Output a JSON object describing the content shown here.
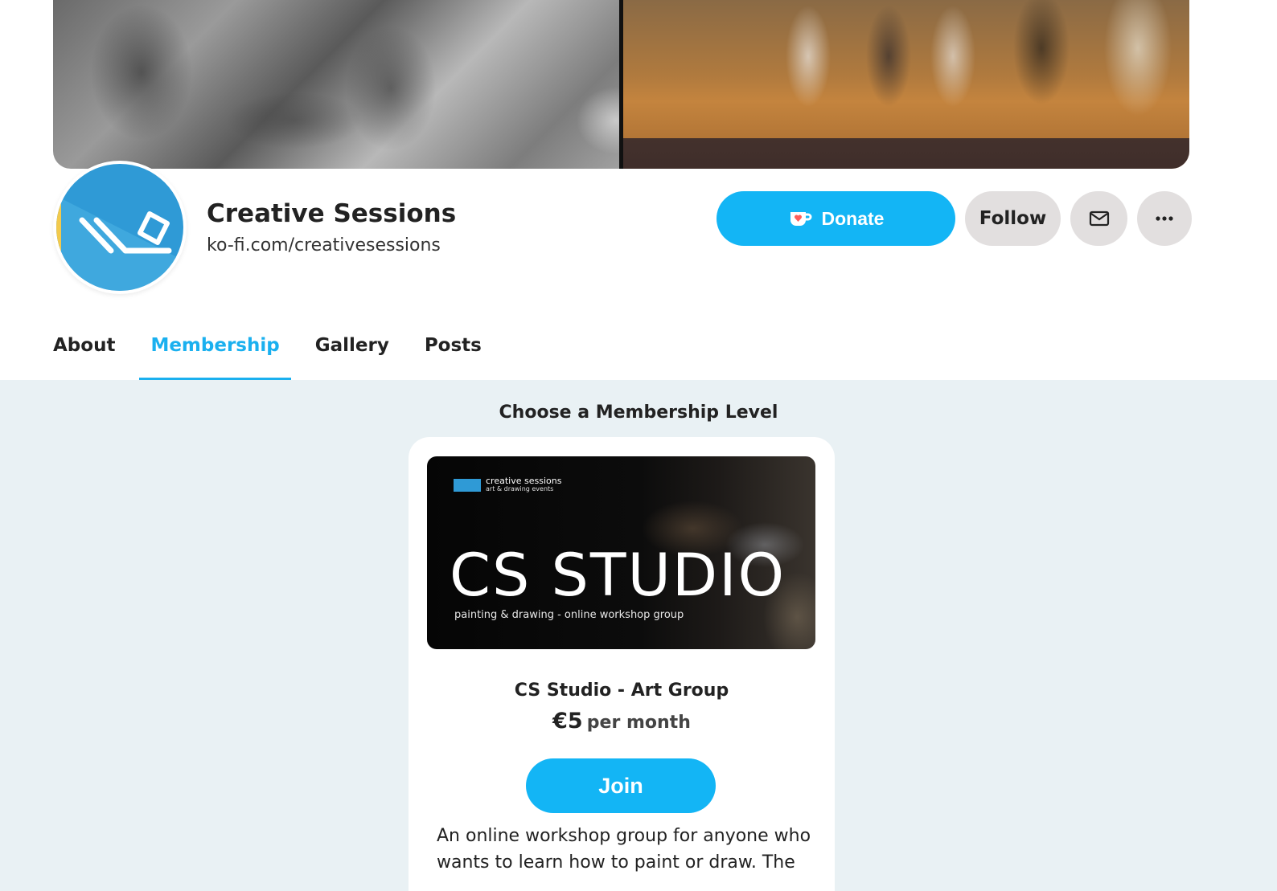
{
  "profile": {
    "name": "Creative Sessions",
    "url": "ko-fi.com/creativesessions"
  },
  "actions": {
    "donate_label": "Donate",
    "follow_label": "Follow",
    "message_icon": "mail-icon",
    "more_icon": "more-dots-icon"
  },
  "tabs": [
    {
      "label": "About",
      "active": false
    },
    {
      "label": "Membership",
      "active": true
    },
    {
      "label": "Gallery",
      "active": false
    },
    {
      "label": "Posts",
      "active": false
    }
  ],
  "membership": {
    "section_title": "Choose a Membership Level",
    "tier": {
      "image": {
        "logo_text": "creative sessions",
        "logo_sub": "art & drawing events",
        "title": "CS STUDIO",
        "subtitle": "painting & drawing - online workshop group"
      },
      "name": "CS Studio - Art Group",
      "price": "€5",
      "period": "per month",
      "join_label": "Join",
      "description": "An online workshop group for anyone who wants to learn how to paint or draw. The"
    }
  },
  "colors": {
    "accent": "#13b5f5",
    "tab_active": "#1ab0ef",
    "neutral_button": "#e2dfdf",
    "page_background": "#e9f1f4"
  }
}
